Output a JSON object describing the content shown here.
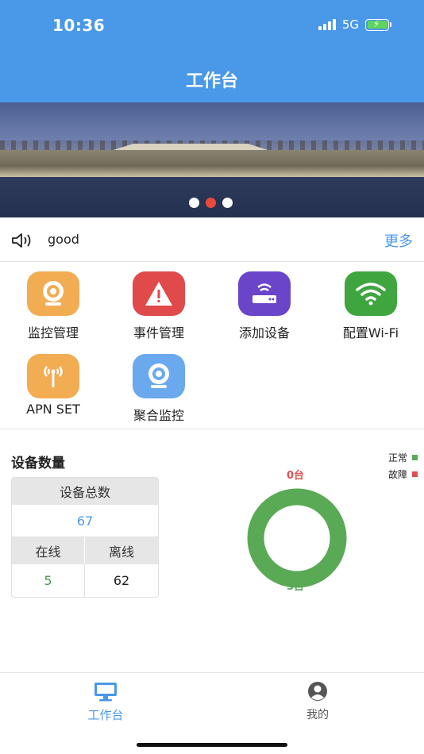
{
  "status_bar": {
    "time": "10:36",
    "network": "5G"
  },
  "header": {
    "title": "工作台"
  },
  "notice": {
    "text": "good",
    "more_label": "更多"
  },
  "grid_items": [
    {
      "label": "监控管理",
      "icon": "camera-icon",
      "color": "#f2ac52"
    },
    {
      "label": "事件管理",
      "icon": "warning-icon",
      "color": "#e04a4a"
    },
    {
      "label": "添加设备",
      "icon": "router-icon",
      "color": "#6a44c9"
    },
    {
      "label": "配置Wi-Fi",
      "icon": "wifi-icon",
      "color": "#3fa63f"
    },
    {
      "label": "APN SET",
      "icon": "antenna-icon",
      "color": "#f2ac52"
    },
    {
      "label": "聚合监控",
      "icon": "camera-icon",
      "color": "#6aa9ee"
    }
  ],
  "device_stats": {
    "title": "设备数量",
    "total_label": "设备总数",
    "total_value": "67",
    "online_label": "在线",
    "offline_label": "离线",
    "online_value": "5",
    "offline_value": "62",
    "legend": [
      {
        "label": "正常",
        "color": "#5aa955"
      },
      {
        "label": "故障",
        "color": "#e05050"
      }
    ],
    "fault_count_label": "0台",
    "normal_count_label": "5台"
  },
  "chart_data": {
    "type": "pie",
    "categories": [
      "正常",
      "故障"
    ],
    "values": [
      5,
      0
    ],
    "colors": [
      "#5aa955",
      "#e05050"
    ]
  },
  "tabbar": {
    "tabs": [
      {
        "label": "工作台",
        "icon": "monitor-icon",
        "active": true
      },
      {
        "label": "我的",
        "icon": "user-icon",
        "active": false
      }
    ]
  },
  "colors": {
    "primary": "#4a98e8",
    "online_text": "#4a9a4a",
    "total_text": "#4a98e8"
  }
}
